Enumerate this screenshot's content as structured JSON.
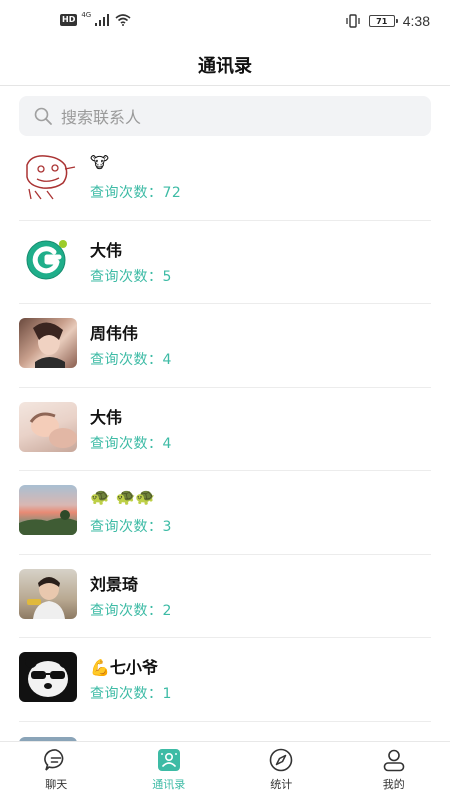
{
  "status_bar": {
    "hd": "HD",
    "network": "4G",
    "battery": "71",
    "time": "4:38"
  },
  "header": {
    "title": "通讯录"
  },
  "search": {
    "placeholder": "搜索联系人"
  },
  "contacts": [
    {
      "name": "🐮",
      "stat": "查询次数：72",
      "avatar": "drawing"
    },
    {
      "name": "大伟",
      "stat": "查询次数：5",
      "avatar": "logo-g"
    },
    {
      "name": "周伟伟",
      "stat": "查询次数：4",
      "avatar": "photo-woman"
    },
    {
      "name": "大伟",
      "stat": "查询次数：4",
      "avatar": "photo-baby"
    },
    {
      "name": "🐢 🐢🐢",
      "stat": "查询次数：3",
      "avatar": "photo-sunset"
    },
    {
      "name": "刘景琦",
      "stat": "查询次数：2",
      "avatar": "photo-child"
    },
    {
      "name": "💪七小爷",
      "stat": "查询次数：1",
      "avatar": "photo-panda"
    }
  ],
  "bottom_nav": [
    {
      "label": "聊天",
      "icon": "chat-icon",
      "active": false
    },
    {
      "label": "通讯录",
      "icon": "contacts-icon",
      "active": true
    },
    {
      "label": "统计",
      "icon": "compass-icon",
      "active": false
    },
    {
      "label": "我的",
      "icon": "profile-icon",
      "active": false
    }
  ],
  "colors": {
    "accent": "#3dbba5",
    "text": "#111111",
    "muted": "#9a9a9a"
  }
}
